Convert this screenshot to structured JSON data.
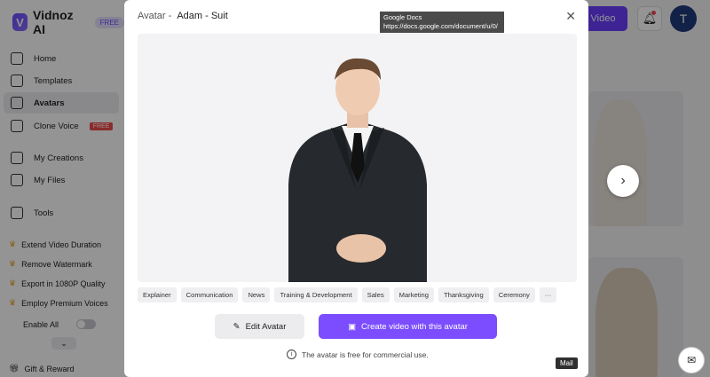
{
  "app": {
    "logo_text": "Vidnoz AI",
    "logo_badge": "FREE",
    "nav": [
      {
        "label": "Home",
        "icon": "home-icon"
      },
      {
        "label": "Templates",
        "icon": "templates-icon"
      },
      {
        "label": "Avatars",
        "icon": "avatars-icon"
      },
      {
        "label": "Clone Voice",
        "icon": "clone-voice-icon",
        "badge": "FREE"
      },
      {
        "label": "My Creations",
        "icon": "play-icon"
      },
      {
        "label": "My Files",
        "icon": "upload-icon"
      },
      {
        "label": "Tools",
        "icon": "tools-icon"
      }
    ],
    "promos": [
      "Extend Video Duration",
      "Remove Watermark",
      "Export in 1080P Quality",
      "Employ Premium Voices"
    ],
    "enable_all": "Enable All",
    "gift": "Gift & Reward",
    "create_video_btn": "Video",
    "user_initial": "T"
  },
  "modal": {
    "prefix": "Avatar -",
    "avatar_name": "Adam - Suit",
    "tags": [
      "Explainer",
      "Communication",
      "News",
      "Training & Development",
      "Sales",
      "Marketing",
      "Thanksgiving",
      "Ceremony",
      "···"
    ],
    "edit_label": "Edit Avatar",
    "create_label": "Create video with this avatar",
    "note": "The avatar is free for commercial use."
  },
  "tooltip": {
    "title": "Google Docs",
    "url": "https://docs.google.com/document/u/0/"
  },
  "mail_tooltip": "Mail",
  "colors": {
    "accent": "#7b4dff",
    "brand": "#6a3dff"
  }
}
